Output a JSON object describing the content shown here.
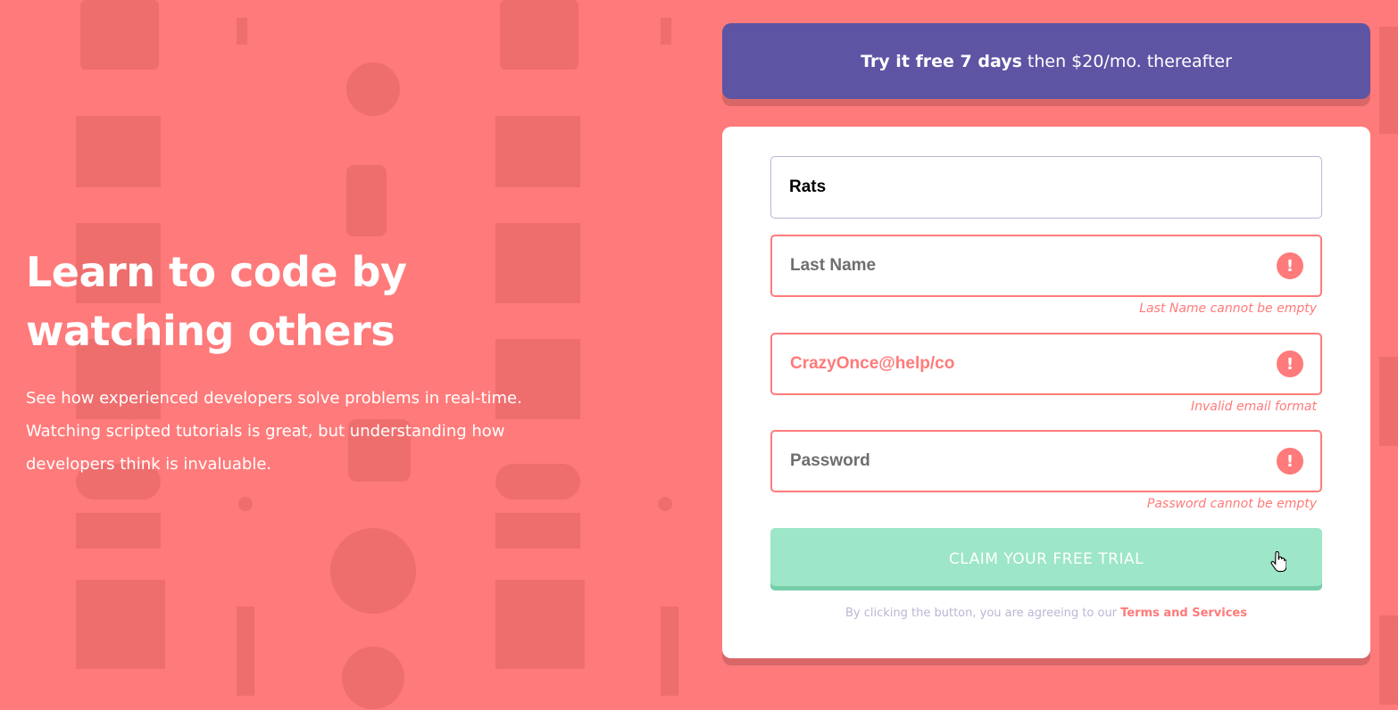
{
  "hero": {
    "heading_line1": "Learn to code by",
    "heading_line2": "watching others",
    "description": "See how experienced developers solve problems in real-time. Watching scripted tutorials is great, but understanding how developers think is invaluable."
  },
  "promo": {
    "bold": "Try it free 7 days",
    "rest": "then $20/mo. thereafter"
  },
  "form": {
    "first_name": {
      "value": "Rats"
    },
    "last_name": {
      "placeholder": "Last Name",
      "error": "Last Name cannot be empty",
      "error_icon": "!"
    },
    "email": {
      "value": "CrazyOnce@help/co",
      "error": "Invalid email format",
      "error_icon": "!"
    },
    "password": {
      "placeholder": "Password",
      "error": "Password cannot be empty",
      "error_icon": "!"
    },
    "submit_label": "CLAIM YOUR FREE TRIAL",
    "terms_text": "By clicking the button, you are agreeing to our",
    "terms_link": "Terms and Services"
  },
  "colors": {
    "background": "#ff7a7a",
    "promo": "#5e54a4",
    "cta": "#9de6c7",
    "error": "#ff7a7a"
  }
}
